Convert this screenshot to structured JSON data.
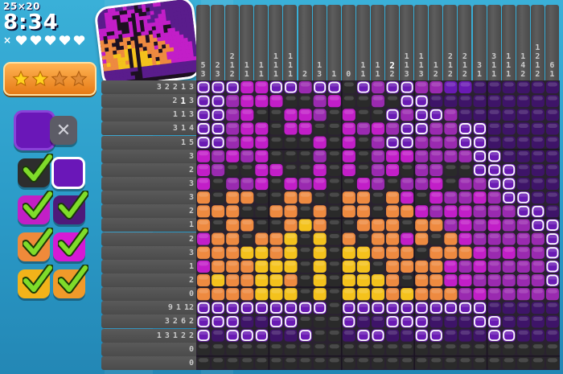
{
  "puzzle": {
    "size_label": "25×20",
    "timer": "8:34",
    "lives_prefix": "×",
    "lives": 5
  },
  "rating": {
    "stars": 4,
    "filled": 2
  },
  "palette": {
    "current": "#6a17b8",
    "erase_label": "✕",
    "swatches": [
      {
        "color": "#2d2d2d",
        "done": true
      },
      {
        "color": "#6a17b8",
        "done": false,
        "selected": true
      },
      {
        "color": "#c21fc6",
        "done": true
      },
      {
        "color": "#4e1a7a",
        "done": true
      },
      {
        "color": "#ef8a3a",
        "done": true
      },
      {
        "color": "#d51ad5",
        "done": true
      },
      {
        "color": "#f2b31a",
        "done": true
      },
      {
        "color": "#f09a2a",
        "done": true
      }
    ]
  },
  "colors": {
    "K": "#2a2a2a",
    "P": "#c21ec8",
    "M": "#9a2ab0",
    "V": "#6a1ab4",
    "D": "#3e1468",
    "O": "#ee8a40",
    "Y": "#f4c21c",
    "E": "#3a3a3a"
  },
  "column_hints": [
    [
      "5",
      "3"
    ],
    [
      "2",
      "3"
    ],
    [
      "2",
      "1",
      "2"
    ],
    [
      "1",
      "1"
    ],
    [
      "1",
      "1"
    ],
    [
      "1",
      "1",
      "1"
    ],
    [
      "1",
      "1",
      "1"
    ],
    [
      "2"
    ],
    [
      "1",
      "3"
    ],
    [
      "1"
    ],
    [
      "0"
    ],
    [
      "1",
      "1"
    ],
    [
      "1",
      "1"
    ],
    [
      "2",
      "2"
    ],
    [
      "1",
      "1",
      "3"
    ],
    [
      "1",
      "1",
      "3"
    ],
    [
      "1",
      "2"
    ],
    [
      "2",
      "1",
      "2"
    ],
    [
      "2",
      "1",
      "2"
    ],
    [
      "3",
      "1"
    ],
    [
      "3",
      "1",
      "1"
    ],
    [
      "1",
      "1",
      "1"
    ],
    [
      "1",
      "4",
      "2"
    ],
    [
      "1",
      "2",
      "1",
      "2"
    ],
    [
      "6",
      "1"
    ]
  ],
  "column_highlight": 13,
  "row_hints": [
    {
      "nums": [
        "3",
        "2",
        "2",
        "1",
        "3"
      ],
      "hl": -1
    },
    {
      "nums": [
        "2",
        "1",
        "3"
      ],
      "hl": 1
    },
    {
      "nums": [
        "1",
        "1",
        "3"
      ],
      "hl": -1
    },
    {
      "nums": [
        "3",
        "1",
        "4"
      ],
      "hl": -1
    },
    {
      "nums": [
        "1",
        "5"
      ],
      "hl": -1
    },
    {
      "nums": [
        "3"
      ],
      "hl": -1
    },
    {
      "nums": [
        "2"
      ],
      "hl": -1
    },
    {
      "nums": [
        "3"
      ],
      "hl": -1
    },
    {
      "nums": [
        "3"
      ],
      "hl": -1
    },
    {
      "nums": [
        "2"
      ],
      "hl": -1
    },
    {
      "nums": [
        "1"
      ],
      "hl": -1
    },
    {
      "nums": [
        "2"
      ],
      "hl": -1
    },
    {
      "nums": [
        "3"
      ],
      "hl": -1
    },
    {
      "nums": [
        "1"
      ],
      "hl": -1
    },
    {
      "nums": [
        "2"
      ],
      "hl": -1
    },
    {
      "nums": [
        "0"
      ],
      "hl": -1
    },
    {
      "nums": [
        "9",
        "1",
        "12"
      ],
      "hl": -1
    },
    {
      "nums": [
        "3",
        "2",
        "6",
        "2"
      ],
      "hl": -1
    },
    {
      "nums": [
        "1",
        "3",
        "1",
        "2",
        "2"
      ],
      "hl": -1
    },
    {
      "nums": [
        "0"
      ],
      "hl": -1
    },
    {
      "nums": [
        "0"
      ],
      "hl": -1
    }
  ],
  "grid": [
    "VVVPPVVMVVKVMVVMMVVDDDDDD",
    "VVMPPPKKMPKKMKVVDDDDDDDDD",
    "VVMPKKPPMKPKKVMVVMDDDDDDD",
    "VVMPPKPPKKPMPMVVMMVVDDDDD",
    "VVMPPKKKPKPKMVVMMMVVDDDDD",
    "PMPMPKKKMKPKMPPMMMMVVDDDD",
    "PMKKPPKKPKPKMPKMMKKVVVDDD",
    "PKMMPKPMPKKPMKMMPKMMVVDDD",
    "OKOOKKOOKKOOKOPKPMMPMVVDD",
    "OOOKKOOKOKOOKOOPMPPMMMVVD",
    "OKOOKKOYOKKOOOKOOMPMPMMVV",
    "POOKOOYKYKOKOOPOKOPMMMMMV",
    "OOOYYOYKYKYYOOOKOOOPMPMMV",
    "POOOYYYKYKYYKOOOOPMPMMMMV",
    "OYOOYYOKYKYYYOKOOPPMMMMMV",
    "OOOOYYYKYKYYYOYOOOMPMMMMM",
    "VVVVVVVVVKVVVVVVVVVVDDDDD",
    "VVVDDVVKKKVDDVVVDDDVVDDDD",
    "VDVVVDDVKKDVVDDVVDDDVVDDD",
    "KKKKKKKKKKKKKKKKKKKKKKKKK",
    "KKKKKKKKKKKKKKKKKKKKKKKKK"
  ],
  "marked_empty": [
    [
      0,
      0
    ],
    [
      0,
      1
    ],
    [
      0,
      2
    ],
    [
      0,
      5
    ],
    [
      0,
      6
    ],
    [
      0,
      8
    ],
    [
      0,
      9
    ],
    [
      0,
      11
    ],
    [
      0,
      13
    ],
    [
      0,
      14
    ],
    [
      1,
      0
    ],
    [
      1,
      1
    ],
    [
      1,
      14
    ],
    [
      1,
      15
    ],
    [
      2,
      0
    ],
    [
      2,
      1
    ],
    [
      2,
      13
    ],
    [
      2,
      15
    ],
    [
      2,
      16
    ],
    [
      3,
      0
    ],
    [
      3,
      1
    ],
    [
      3,
      14
    ],
    [
      3,
      15
    ],
    [
      3,
      18
    ],
    [
      3,
      19
    ],
    [
      4,
      0
    ],
    [
      4,
      1
    ],
    [
      4,
      13
    ],
    [
      4,
      14
    ],
    [
      4,
      18
    ],
    [
      4,
      19
    ],
    [
      5,
      19
    ],
    [
      5,
      20
    ],
    [
      6,
      19
    ],
    [
      6,
      20
    ],
    [
      6,
      21
    ],
    [
      7,
      20
    ],
    [
      7,
      21
    ],
    [
      8,
      21
    ],
    [
      8,
      22
    ],
    [
      9,
      22
    ],
    [
      9,
      23
    ],
    [
      10,
      23
    ],
    [
      10,
      24
    ],
    [
      11,
      24
    ],
    [
      12,
      24
    ],
    [
      13,
      24
    ],
    [
      14,
      24
    ],
    [
      16,
      0
    ],
    [
      16,
      1
    ],
    [
      16,
      2
    ],
    [
      16,
      3
    ],
    [
      16,
      4
    ],
    [
      16,
      5
    ],
    [
      16,
      6
    ],
    [
      16,
      7
    ],
    [
      16,
      8
    ],
    [
      16,
      10
    ],
    [
      16,
      11
    ],
    [
      16,
      12
    ],
    [
      16,
      13
    ],
    [
      16,
      14
    ],
    [
      16,
      15
    ],
    [
      16,
      16
    ],
    [
      16,
      17
    ],
    [
      16,
      18
    ],
    [
      16,
      19
    ],
    [
      17,
      0
    ],
    [
      17,
      1
    ],
    [
      17,
      2
    ],
    [
      17,
      5
    ],
    [
      17,
      6
    ],
    [
      17,
      10
    ],
    [
      17,
      13
    ],
    [
      17,
      14
    ],
    [
      17,
      15
    ],
    [
      17,
      19
    ],
    [
      17,
      20
    ],
    [
      18,
      0
    ],
    [
      18,
      2
    ],
    [
      18,
      3
    ],
    [
      18,
      4
    ],
    [
      18,
      7
    ],
    [
      18,
      11
    ],
    [
      18,
      12
    ],
    [
      18,
      15
    ],
    [
      18,
      16
    ],
    [
      18,
      20
    ],
    [
      18,
      21
    ]
  ],
  "preview_colors": {
    "sky_top": "#5a1c8c",
    "sky_mid": "#c21ec8",
    "sky_low": "#ee8a40",
    "sun": "#f4c21c",
    "tree": "#1c1020"
  }
}
